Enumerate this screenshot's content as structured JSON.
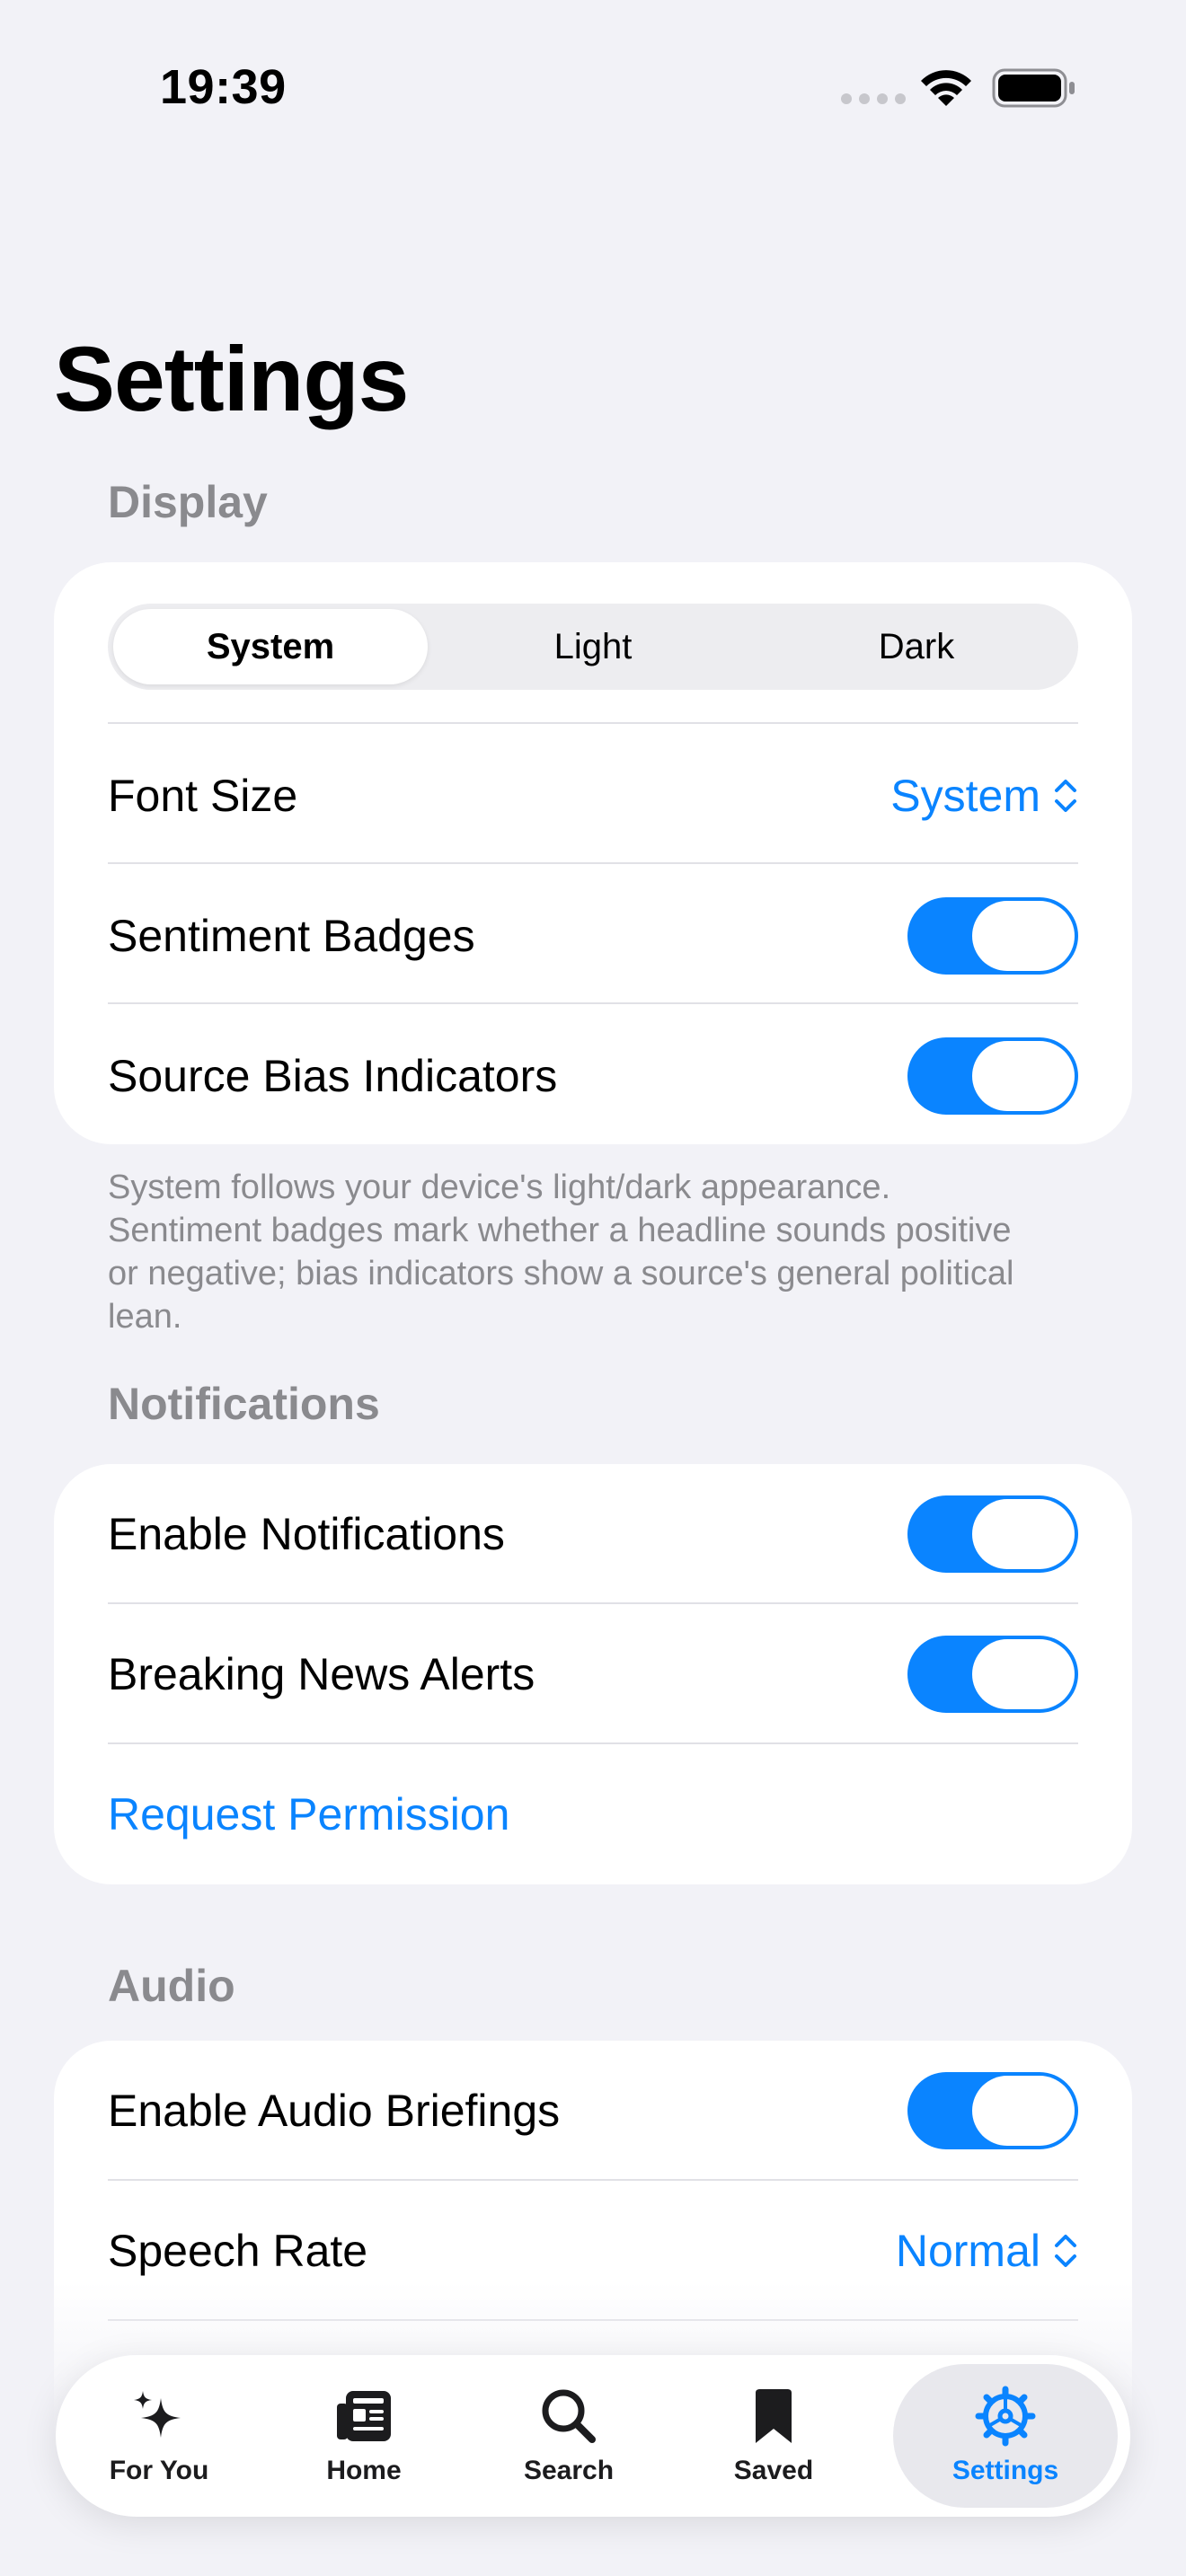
{
  "status_bar": {
    "time": "19:39"
  },
  "page": {
    "title": "Settings"
  },
  "display": {
    "header": "Display",
    "appearance": {
      "options": [
        "System",
        "Light",
        "Dark"
      ],
      "selected": "System"
    },
    "font_size": {
      "label": "Font Size",
      "value": "System"
    },
    "sentiment_badges": {
      "label": "Sentiment Badges",
      "on": true
    },
    "source_bias": {
      "label": "Source Bias Indicators",
      "on": true
    },
    "footer": "System follows your device's light/dark appearance. Sentiment badges mark whether a headline sounds positive or negative; bias indicators show a source's general political lean."
  },
  "notifications": {
    "header": "Notifications",
    "enable": {
      "label": "Enable Notifications",
      "on": true
    },
    "breaking": {
      "label": "Breaking News Alerts",
      "on": true
    },
    "request": "Request Permission"
  },
  "audio": {
    "header": "Audio",
    "enable": {
      "label": "Enable Audio Briefings",
      "on": true
    },
    "speech_rate": {
      "label": "Speech Rate",
      "value": "Normal"
    }
  },
  "tab_bar": {
    "items": [
      {
        "label": "For You",
        "icon": "sparkles-icon"
      },
      {
        "label": "Home",
        "icon": "newspaper-icon"
      },
      {
        "label": "Search",
        "icon": "magnifying-glass-icon"
      },
      {
        "label": "Saved",
        "icon": "bookmark-icon"
      },
      {
        "label": "Settings",
        "icon": "gear-icon"
      }
    ],
    "active": "Settings"
  },
  "colors": {
    "accent": "#0A84FF",
    "background": "#F2F2F7",
    "secondary_text": "#8A8A8E"
  }
}
